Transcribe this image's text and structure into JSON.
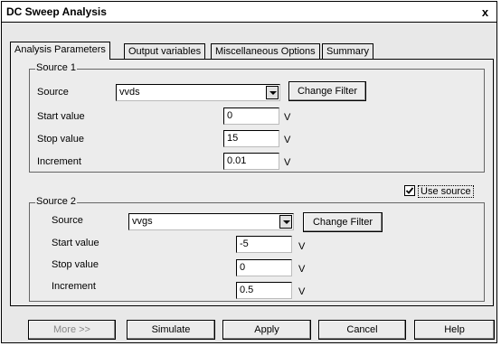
{
  "window": {
    "title": "DC Sweep Analysis",
    "close_glyph": "x"
  },
  "tabs": [
    {
      "label": "Analysis Parameters"
    },
    {
      "label": "Output variables"
    },
    {
      "label": "Miscellaneous Options"
    },
    {
      "label": "Summary"
    }
  ],
  "source1": {
    "group_label": "Source 1",
    "source_label": "Source",
    "source_value": "vvds",
    "change_filter": "Change Filter",
    "start_label": "Start value",
    "start_value": "0",
    "stop_label": "Stop value",
    "stop_value": "15",
    "increment_label": "Increment",
    "increment_value": "0.01",
    "unit": "V"
  },
  "use_source": {
    "label": "Use source",
    "checked": true
  },
  "source2": {
    "group_label": "Source 2",
    "source_label": "Source",
    "source_value": "vvgs",
    "change_filter": "Change Filter",
    "start_label": "Start value",
    "start_value": "-5",
    "stop_label": "Stop value",
    "stop_value": "0",
    "increment_label": "Increment",
    "increment_value": "0.5",
    "unit": "V"
  },
  "buttons": {
    "more": "More >>",
    "simulate": "Simulate",
    "apply": "Apply",
    "cancel": "Cancel",
    "help": "Help"
  }
}
